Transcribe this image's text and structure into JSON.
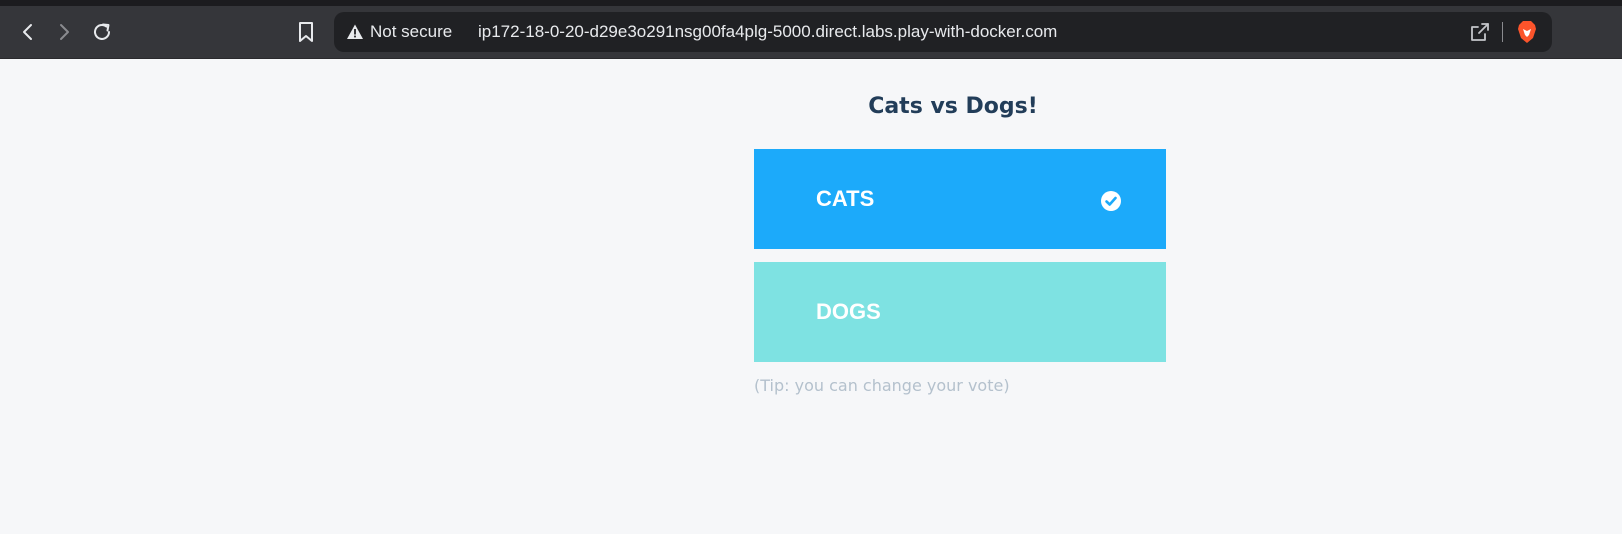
{
  "browser": {
    "security_label": "Not secure",
    "url": "ip172-18-0-20-d29e3o291nsg00fa4plg-5000.direct.labs.play-with-docker.com",
    "icons": [
      "back-icon",
      "forward-icon",
      "reload-icon",
      "bookmark-icon",
      "warning-icon",
      "share-icon",
      "brave-shield-icon"
    ]
  },
  "page": {
    "title": "Cats vs Dogs!",
    "options": [
      {
        "label": "CATS",
        "selected": true,
        "color": "#1caafa"
      },
      {
        "label": "DOGS",
        "selected": false,
        "color": "#7ee2e2"
      }
    ],
    "tip": "(Tip: you can change your vote)"
  }
}
